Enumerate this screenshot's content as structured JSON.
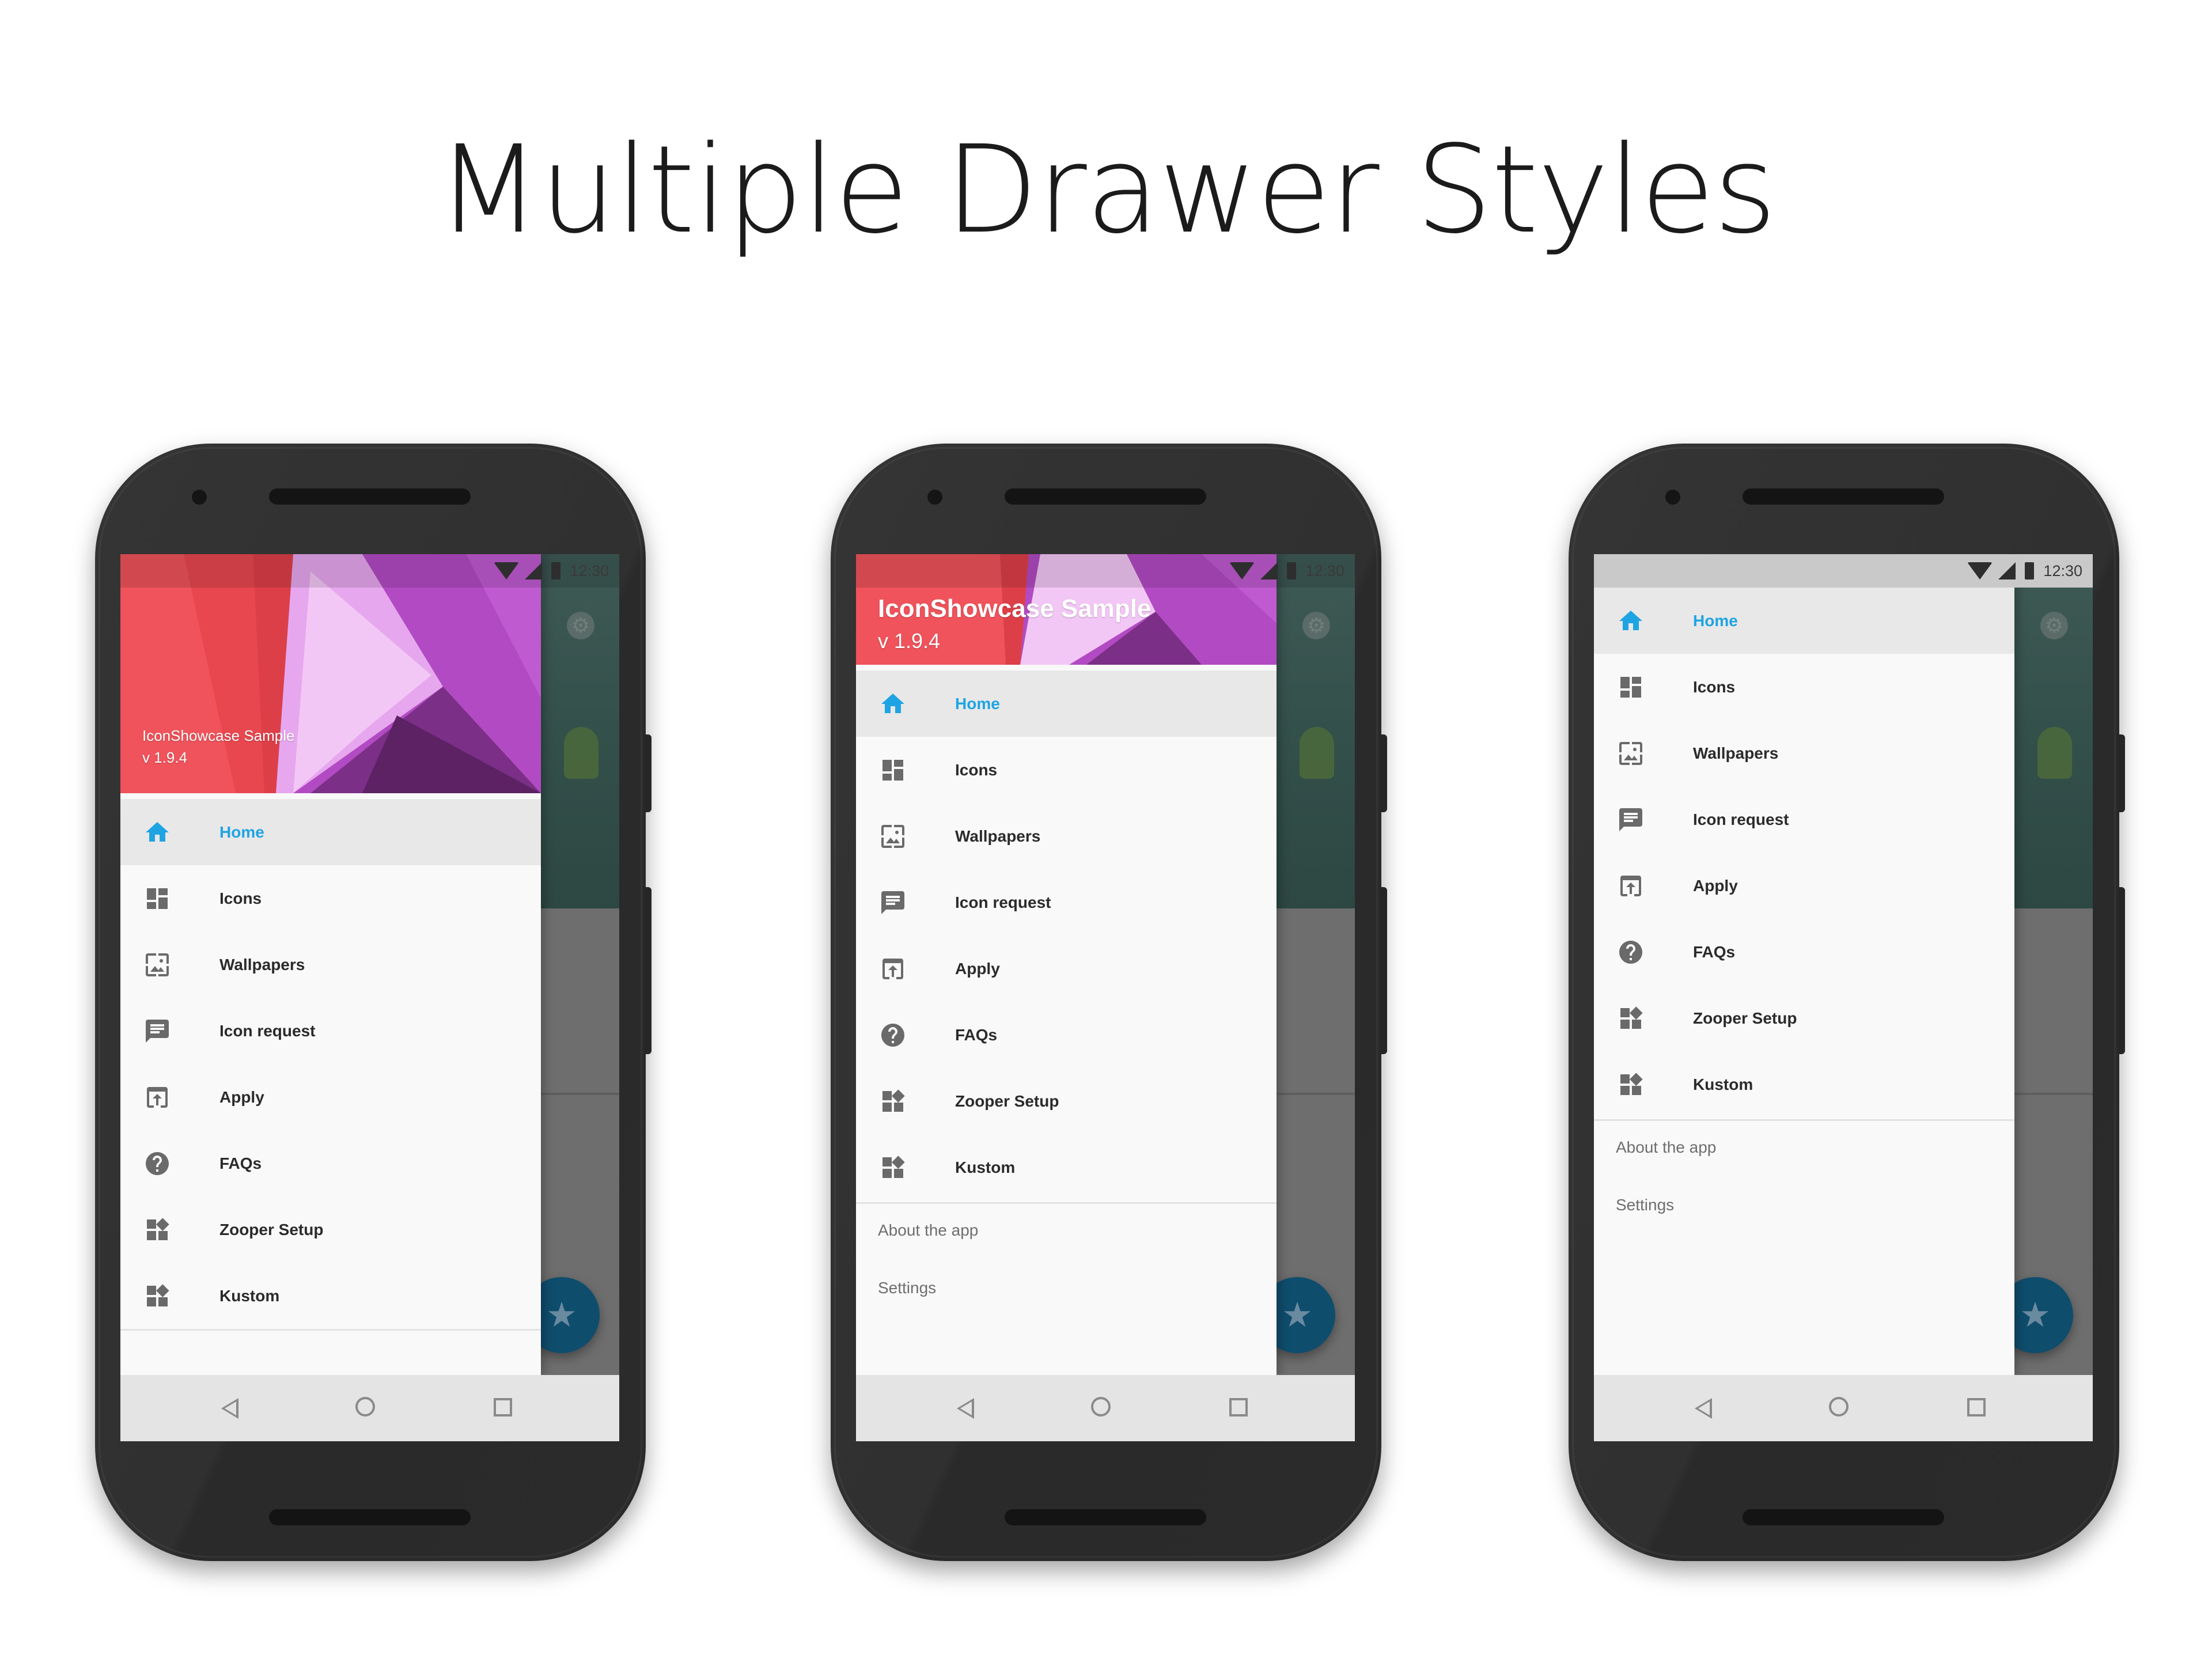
{
  "headline": "Multiple Drawer Styles",
  "status_bar": {
    "time": "12:30"
  },
  "app_header": {
    "title": "IconShowcase Sample",
    "version": "v 1.9.4"
  },
  "menu_items": [
    {
      "label": "Home",
      "icon": "home-icon",
      "active": true
    },
    {
      "label": "Icons",
      "icon": "dashboard-icon",
      "active": false
    },
    {
      "label": "Wallpapers",
      "icon": "wallpaper-icon",
      "active": false
    },
    {
      "label": "Icon request",
      "icon": "comment-icon",
      "active": false
    },
    {
      "label": "Apply",
      "icon": "apply-icon",
      "active": false
    },
    {
      "label": "FAQs",
      "icon": "help-icon",
      "active": false
    },
    {
      "label": "Zooper Setup",
      "icon": "widgets-icon",
      "active": false
    },
    {
      "label": "Kustom",
      "icon": "widgets-icon",
      "active": false
    }
  ],
  "secondary_items": [
    {
      "label": "About the app"
    },
    {
      "label": "Settings"
    }
  ],
  "colors": {
    "accent": "#1fa4e3",
    "drawer_bg": "#f9f9f9",
    "fab": "#0f4d6d",
    "header_red": "#ee5158",
    "header_purple": "#b24bc3"
  }
}
